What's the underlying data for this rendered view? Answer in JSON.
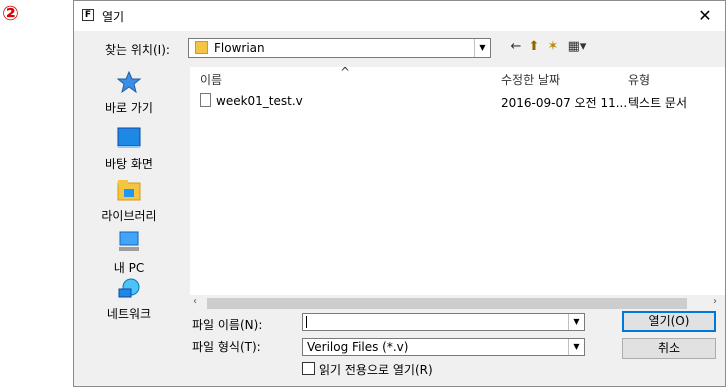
{
  "step_badge": "②",
  "window": {
    "title": "열기",
    "title_icon_glyph": "F",
    "close_glyph": "✕"
  },
  "lookin": {
    "label": "찾는 위치(I):",
    "value": "Flowrian"
  },
  "toolbar": {
    "back_glyph": "←",
    "up_glyph": "⬆",
    "newfolder_glyph": "✶",
    "view_glyph": "▦▾"
  },
  "places": [
    {
      "label": "바로 가기",
      "icon": "star-icon"
    },
    {
      "label": "바탕 화면",
      "icon": "desktop-icon"
    },
    {
      "label": "라이브러리",
      "icon": "library-icon"
    },
    {
      "label": "내 PC",
      "icon": "computer-icon"
    },
    {
      "label": "네트워크",
      "icon": "network-icon"
    }
  ],
  "filelist": {
    "sort_glyph": "^",
    "columns": [
      "이름",
      "수정한 날짜",
      "유형"
    ],
    "rows": [
      {
        "name": "week01_test.v",
        "date": "2016-09-07 오전 11...",
        "type": "텍스트 문서"
      }
    ]
  },
  "form": {
    "filename_label": "파일 이름(N):",
    "filename_value": "",
    "filetype_label": "파일 형식(T):",
    "filetype_value": "Verilog Files (*.v)",
    "readonly_label": "읽기 전용으로 열기(R)",
    "open_button": "열기(O)",
    "cancel_button": "취소"
  },
  "colors": {
    "badge": "#e00000",
    "default_button_border": "#0078d7"
  }
}
